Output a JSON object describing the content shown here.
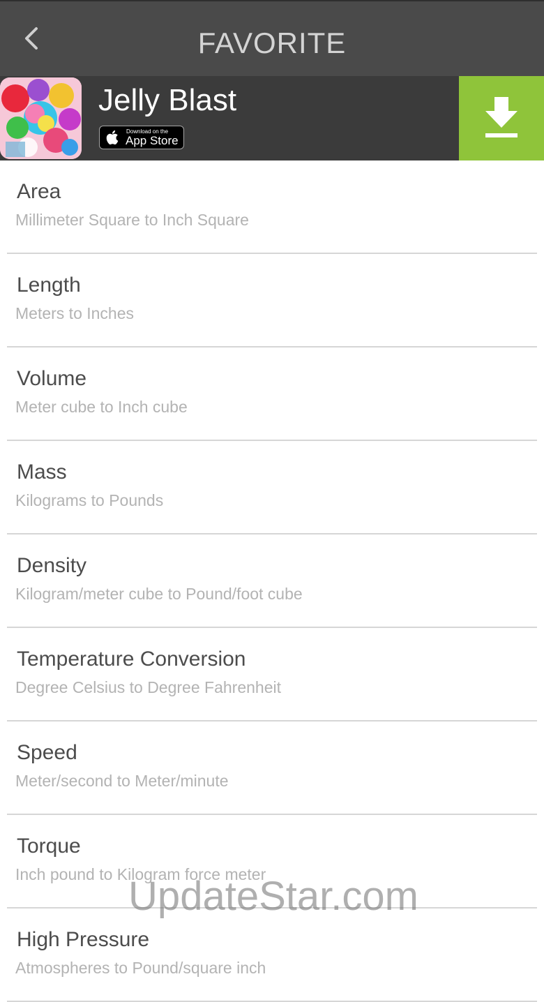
{
  "header": {
    "title": "FAVORITE"
  },
  "ad": {
    "title": "Jelly Blast",
    "badge_small": "Download on the",
    "badge_big": "App Store",
    "accent_color": "#8fc43a"
  },
  "items": [
    {
      "title": "Area",
      "subtitle": "Millimeter Square to Inch Square"
    },
    {
      "title": "Length",
      "subtitle": "Meters to Inches"
    },
    {
      "title": "Volume",
      "subtitle": "Meter cube to Inch cube"
    },
    {
      "title": "Mass",
      "subtitle": "Kilograms to Pounds"
    },
    {
      "title": "Density",
      "subtitle": "Kilogram/meter cube to Pound/foot cube"
    },
    {
      "title": "Temperature Conversion",
      "subtitle": "Degree Celsius to Degree Fahrenheit"
    },
    {
      "title": "Speed",
      "subtitle": "Meter/second to Meter/minute"
    },
    {
      "title": "Torque",
      "subtitle": "Inch pound to Kilogram force meter"
    },
    {
      "title": "High Pressure",
      "subtitle": "Atmospheres to Pound/square inch"
    }
  ],
  "watermark": "UpdateStar.com",
  "icons": {
    "back": "chevron-left-icon",
    "download": "download-arrow-icon",
    "apple": "apple-logo-icon"
  }
}
